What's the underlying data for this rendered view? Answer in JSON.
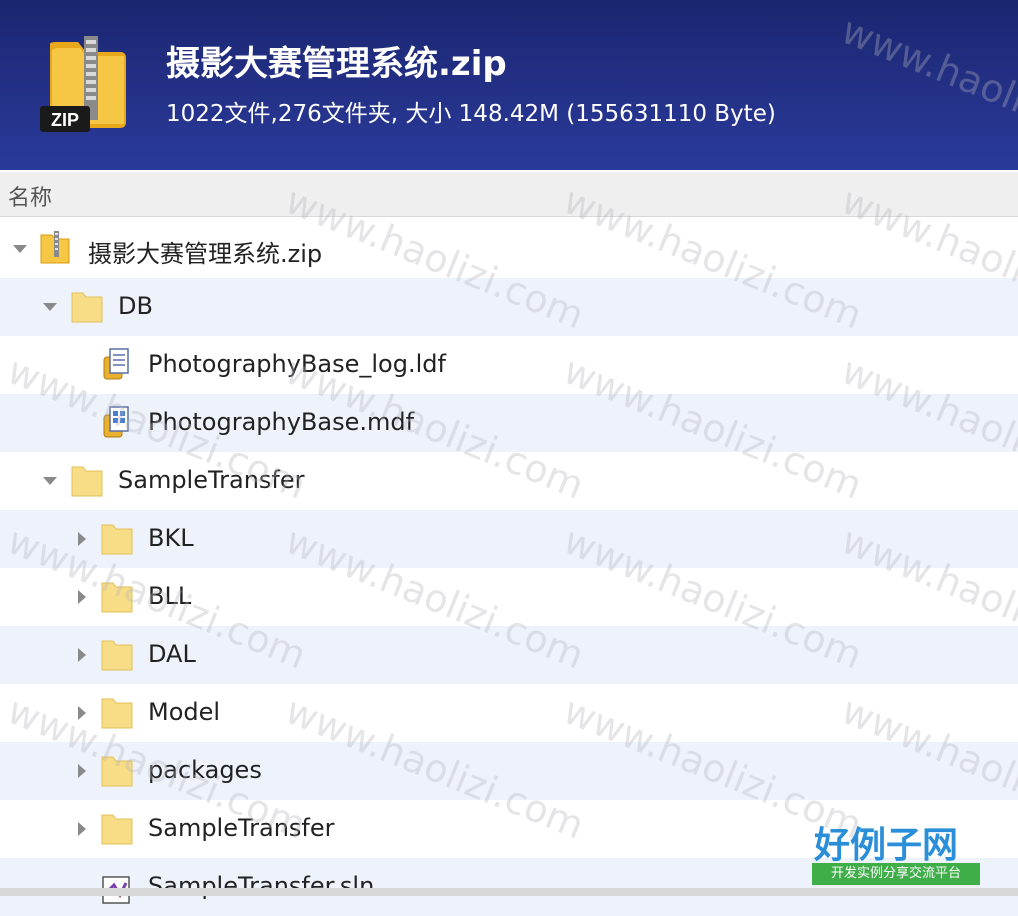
{
  "header": {
    "title": "摄影大赛管理系统.zip",
    "summary": "1022文件,276文件夹, 大小 148.42M (155631110 Byte)",
    "zip_badge": "ZIP"
  },
  "columns": {
    "name": "名称"
  },
  "tree": {
    "rows": [
      {
        "label": "摄影大赛管理系统.zip",
        "icon": "zip-file-icon",
        "expanded": true
      },
      {
        "label": "DB",
        "icon": "folder-icon",
        "expanded": true
      },
      {
        "label": "PhotographyBase_log.ldf",
        "icon": "database-log-file-icon"
      },
      {
        "label": "PhotographyBase.mdf",
        "icon": "database-file-icon"
      },
      {
        "label": "SampleTransfer",
        "icon": "folder-icon",
        "expanded": true
      },
      {
        "label": "BKL",
        "icon": "folder-icon",
        "expanded": false
      },
      {
        "label": "BLL",
        "icon": "folder-icon",
        "expanded": false
      },
      {
        "label": "DAL",
        "icon": "folder-icon",
        "expanded": false
      },
      {
        "label": "Model",
        "icon": "folder-icon",
        "expanded": false
      },
      {
        "label": "packages",
        "icon": "folder-icon",
        "expanded": false
      },
      {
        "label": "SampleTransfer",
        "icon": "folder-icon",
        "expanded": false
      },
      {
        "label": "SampleTransfer.sln",
        "icon": "visual-studio-solution-icon"
      }
    ]
  },
  "watermark": {
    "text": "www.haolizi.com"
  },
  "brand": {
    "title": "好例子网",
    "subtitle": "开发实例分享交流平台"
  },
  "colors": {
    "header_bg": "#1f2b7a",
    "row_alt": "#eef3fb",
    "folder": "#f7dd86",
    "brand_blue": "#2a8fd8",
    "brand_green": "#3fae49"
  }
}
